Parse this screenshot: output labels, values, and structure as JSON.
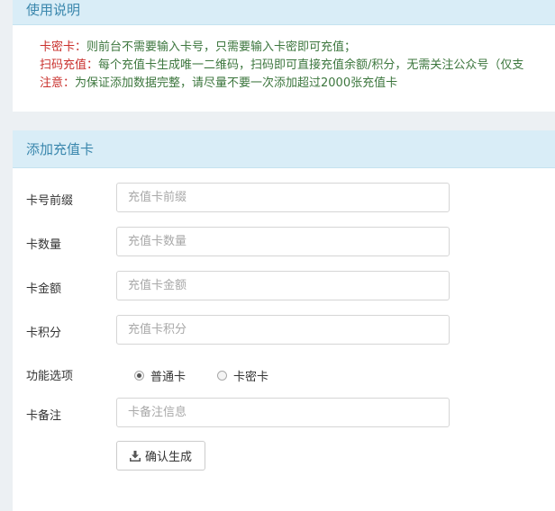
{
  "usage_panel": {
    "title": "使用说明",
    "notes": [
      {
        "key": "卡密卡：",
        "text": "则前台不需要输入卡号，只需要输入卡密即可充值；"
      },
      {
        "key": "扫码充值：",
        "text": "每个充值卡生成唯一二维码，扫码即可直接充值余额/积分，无需关注公众号（仅支"
      },
      {
        "key": "注意：",
        "text": "为保证添加数据完整，请尽量不要一次添加超过2000张充值卡"
      }
    ]
  },
  "form_panel": {
    "title": "添加充值卡",
    "fields": {
      "prefix": {
        "label": "卡号前缀",
        "placeholder": "充值卡前缀",
        "value": ""
      },
      "quantity": {
        "label": "卡数量",
        "placeholder": "充值卡数量",
        "value": ""
      },
      "amount": {
        "label": "卡金额",
        "placeholder": "充值卡金额",
        "value": ""
      },
      "points": {
        "label": "卡积分",
        "placeholder": "充值卡积分",
        "value": ""
      },
      "remark": {
        "label": "卡备注",
        "placeholder": "卡备注信息",
        "value": ""
      }
    },
    "options": {
      "label": "功能选项",
      "choices": [
        {
          "label": "普通卡",
          "checked": true
        },
        {
          "label": "卡密卡",
          "checked": false
        }
      ]
    },
    "submit_label": "确认生成",
    "submit_icon": "download-icon"
  }
}
